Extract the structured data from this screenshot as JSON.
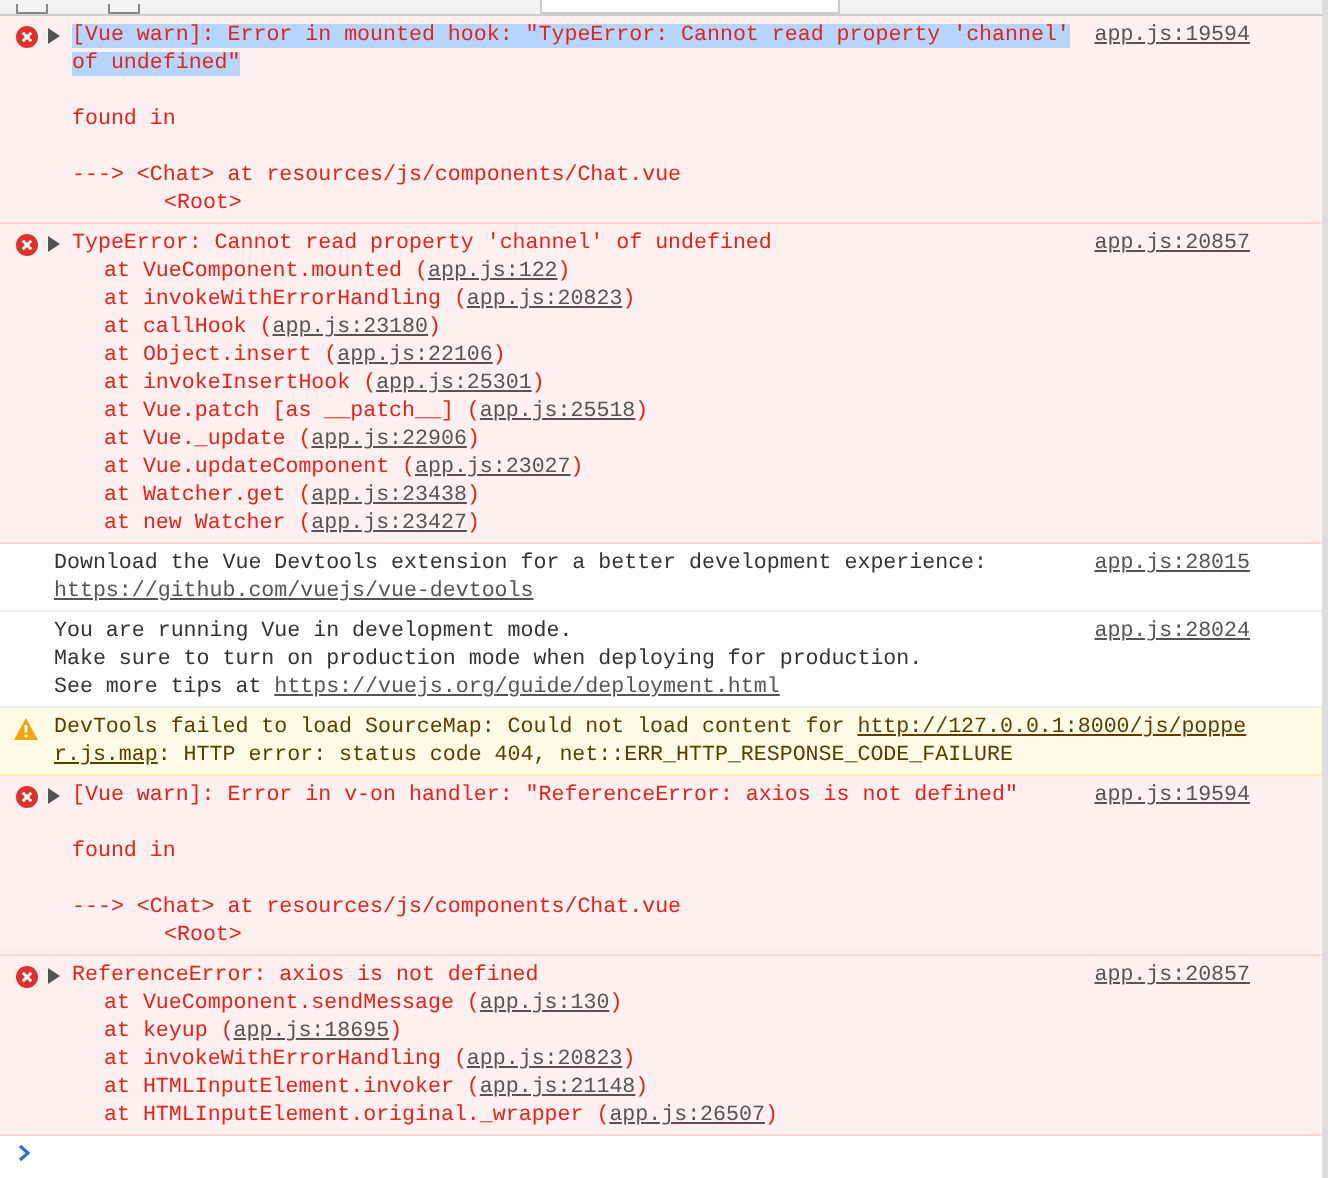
{
  "messages": [
    {
      "kind": "error",
      "expandable": true,
      "selected": true,
      "source": "app.js:19594",
      "lines": [
        {
          "kind": "text",
          "parts": [
            {
              "text": "[Vue warn]: Error in mounted hook: \"TypeError: Cannot read property 'channel'",
              "link": false
            }
          ]
        },
        {
          "kind": "text",
          "parts": [
            {
              "text": "of undefined\"",
              "link": false
            }
          ]
        },
        {
          "kind": "blank"
        },
        {
          "kind": "text",
          "parts": [
            {
              "text": "found in",
              "link": false
            }
          ]
        },
        {
          "kind": "blank"
        },
        {
          "kind": "text",
          "parts": [
            {
              "text": "---> <Chat> at resources/js/components/Chat.vue",
              "link": false
            }
          ]
        },
        {
          "kind": "nested",
          "parts": [
            {
              "text": "<Root>",
              "link": false
            }
          ]
        }
      ]
    },
    {
      "kind": "error",
      "expandable": true,
      "selected": false,
      "source": "app.js:20857",
      "lines": [
        {
          "kind": "text",
          "parts": [
            {
              "text": "TypeError: Cannot read property 'channel' of undefined",
              "link": false
            }
          ]
        },
        {
          "kind": "frame",
          "parts": [
            {
              "text": "at VueComponent.mounted (",
              "link": false
            },
            {
              "text": "app.js:122",
              "link": true
            },
            {
              "text": ")",
              "link": false
            }
          ]
        },
        {
          "kind": "frame",
          "parts": [
            {
              "text": "at invokeWithErrorHandling (",
              "link": false
            },
            {
              "text": "app.js:20823",
              "link": true
            },
            {
              "text": ")",
              "link": false
            }
          ]
        },
        {
          "kind": "frame",
          "parts": [
            {
              "text": "at callHook (",
              "link": false
            },
            {
              "text": "app.js:23180",
              "link": true
            },
            {
              "text": ")",
              "link": false
            }
          ]
        },
        {
          "kind": "frame",
          "parts": [
            {
              "text": "at Object.insert (",
              "link": false
            },
            {
              "text": "app.js:22106",
              "link": true
            },
            {
              "text": ")",
              "link": false
            }
          ]
        },
        {
          "kind": "frame",
          "parts": [
            {
              "text": "at invokeInsertHook (",
              "link": false
            },
            {
              "text": "app.js:25301",
              "link": true
            },
            {
              "text": ")",
              "link": false
            }
          ]
        },
        {
          "kind": "frame",
          "parts": [
            {
              "text": "at Vue.patch [as __patch__] (",
              "link": false
            },
            {
              "text": "app.js:25518",
              "link": true
            },
            {
              "text": ")",
              "link": false
            }
          ]
        },
        {
          "kind": "frame",
          "parts": [
            {
              "text": "at Vue._update (",
              "link": false
            },
            {
              "text": "app.js:22906",
              "link": true
            },
            {
              "text": ")",
              "link": false
            }
          ]
        },
        {
          "kind": "frame",
          "parts": [
            {
              "text": "at Vue.updateComponent (",
              "link": false
            },
            {
              "text": "app.js:23027",
              "link": true
            },
            {
              "text": ")",
              "link": false
            }
          ]
        },
        {
          "kind": "frame",
          "parts": [
            {
              "text": "at Watcher.get (",
              "link": false
            },
            {
              "text": "app.js:23438",
              "link": true
            },
            {
              "text": ")",
              "link": false
            }
          ]
        },
        {
          "kind": "frame",
          "parts": [
            {
              "text": "at new Watcher (",
              "link": false
            },
            {
              "text": "app.js:23427",
              "link": true
            },
            {
              "text": ")",
              "link": false
            }
          ]
        }
      ]
    },
    {
      "kind": "info",
      "expandable": false,
      "selected": false,
      "source": "app.js:28015",
      "lines": [
        {
          "kind": "text",
          "parts": [
            {
              "text": "Download the Vue Devtools extension for a better development experience:",
              "link": false
            }
          ]
        },
        {
          "kind": "text",
          "parts": [
            {
              "text": "https://github.com/vuejs/vue-devtools",
              "link": true
            }
          ]
        }
      ]
    },
    {
      "kind": "info",
      "expandable": false,
      "selected": false,
      "source": "app.js:28024",
      "lines": [
        {
          "kind": "text",
          "parts": [
            {
              "text": "You are running Vue in development mode.",
              "link": false
            }
          ]
        },
        {
          "kind": "text",
          "parts": [
            {
              "text": "Make sure to turn on production mode when deploying for production.",
              "link": false
            }
          ]
        },
        {
          "kind": "text",
          "parts": [
            {
              "text": "See more tips at ",
              "link": false
            },
            {
              "text": "https://vuejs.org/guide/deployment.html",
              "link": true
            }
          ]
        }
      ]
    },
    {
      "kind": "warning",
      "expandable": false,
      "selected": false,
      "lines": [
        {
          "kind": "text",
          "parts": [
            {
              "text": "DevTools failed to load SourceMap: Could not load content for ",
              "link": false
            },
            {
              "text": "http://127.0.0.1:8000/js/poppe",
              "link": true
            }
          ]
        },
        {
          "kind": "text",
          "parts": [
            {
              "text": "r.js.map",
              "link": true
            },
            {
              "text": ": HTTP error: status code 404, net::ERR_HTTP_RESPONSE_CODE_FAILURE",
              "link": false
            }
          ]
        }
      ]
    },
    {
      "kind": "error",
      "expandable": true,
      "selected": false,
      "source": "app.js:19594",
      "lines": [
        {
          "kind": "text",
          "parts": [
            {
              "text": "[Vue warn]: Error in v-on handler: \"ReferenceError: axios is not defined\"",
              "link": false
            }
          ]
        },
        {
          "kind": "blank"
        },
        {
          "kind": "text",
          "parts": [
            {
              "text": "found in",
              "link": false
            }
          ]
        },
        {
          "kind": "blank"
        },
        {
          "kind": "text",
          "parts": [
            {
              "text": "---> <Chat> at resources/js/components/Chat.vue",
              "link": false
            }
          ]
        },
        {
          "kind": "nested",
          "parts": [
            {
              "text": "<Root>",
              "link": false
            }
          ]
        }
      ]
    },
    {
      "kind": "error",
      "expandable": true,
      "selected": false,
      "source": "app.js:20857",
      "lines": [
        {
          "kind": "text",
          "parts": [
            {
              "text": "ReferenceError: axios is not defined",
              "link": false
            }
          ]
        },
        {
          "kind": "frame",
          "parts": [
            {
              "text": "at VueComponent.sendMessage (",
              "link": false
            },
            {
              "text": "app.js:130",
              "link": true
            },
            {
              "text": ")",
              "link": false
            }
          ]
        },
        {
          "kind": "frame",
          "parts": [
            {
              "text": "at keyup (",
              "link": false
            },
            {
              "text": "app.js:18695",
              "link": true
            },
            {
              "text": ")",
              "link": false
            }
          ]
        },
        {
          "kind": "frame",
          "parts": [
            {
              "text": "at invokeWithErrorHandling (",
              "link": false
            },
            {
              "text": "app.js:20823",
              "link": true
            },
            {
              "text": ")",
              "link": false
            }
          ]
        },
        {
          "kind": "frame",
          "parts": [
            {
              "text": "at HTMLInputElement.invoker (",
              "link": false
            },
            {
              "text": "app.js:21148",
              "link": true
            },
            {
              "text": ")",
              "link": false
            }
          ]
        },
        {
          "kind": "frame",
          "parts": [
            {
              "text": "at HTMLInputElement.original._wrapper (",
              "link": false
            },
            {
              "text": "app.js:26507",
              "link": true
            },
            {
              "text": ")",
              "link": false
            }
          ]
        }
      ]
    }
  ]
}
